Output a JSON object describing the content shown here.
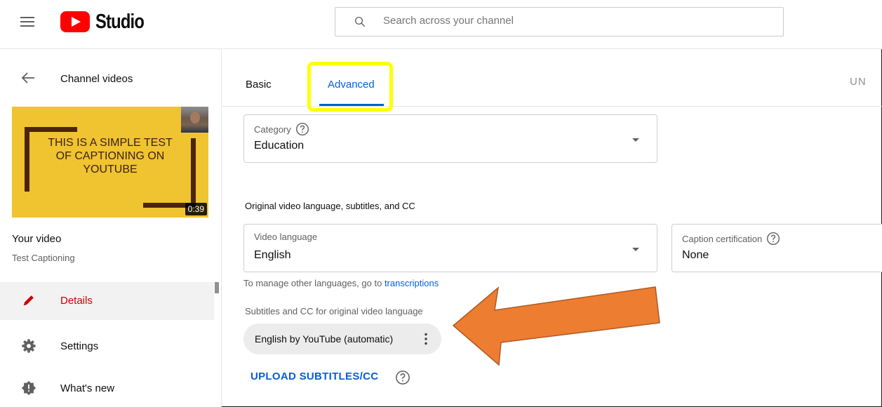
{
  "header": {
    "logo_text": "Studio",
    "search_placeholder": "Search across your channel"
  },
  "sidebar": {
    "back_label": "Channel videos",
    "thumbnail_text": "THIS IS A SIMPLE TEST OF CAPTIONING ON YOUTUBE",
    "thumbnail_duration": "0:39",
    "your_video_label": "Your video",
    "video_title": "Test Captioning",
    "nav": [
      {
        "label": "Details",
        "icon": "pencil-icon",
        "active": true
      },
      {
        "label": "Settings",
        "icon": "gear-icon",
        "active": false
      },
      {
        "label": "What's new",
        "icon": "badge-icon",
        "active": false
      }
    ]
  },
  "main": {
    "tabs": [
      {
        "label": "Basic",
        "active": false
      },
      {
        "label": "Advanced",
        "active": true
      }
    ],
    "undo_label": "UN",
    "category": {
      "label": "Category",
      "value": "Education"
    },
    "original_language_section": "Original video language, subtitles, and CC",
    "video_language": {
      "label": "Video language",
      "value": "English"
    },
    "caption_certification": {
      "label": "Caption certification",
      "value": "None"
    },
    "manage_text": "To manage other languages, go to ",
    "manage_link": "transcriptions",
    "subtitles_label": "Subtitles and CC for original video language",
    "subtitle_chip": "English by YouTube (automatic)",
    "upload_button": "UPLOAD SUBTITLES/CC"
  },
  "colors": {
    "accent_blue": "#065fd4",
    "active_red": "#cc0000",
    "highlight_yellow": "#ffff00",
    "arrow_orange": "#ed7d31",
    "thumbnail_yellow": "#f0c330"
  }
}
